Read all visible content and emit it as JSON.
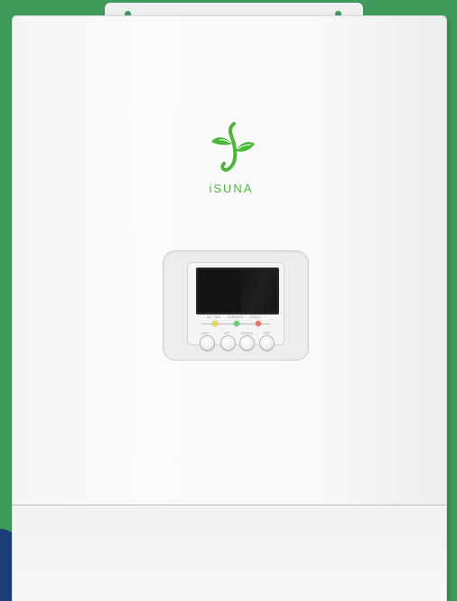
{
  "brand": {
    "name": "iSUNA",
    "color": "#4cb63a"
  },
  "indicators": [
    {
      "label": "AC / INV",
      "color": "#f2d544"
    },
    {
      "label": "CHARGE",
      "color": "#5fd269"
    },
    {
      "label": "FAULT",
      "color": "#ef6e62"
    }
  ],
  "buttons": [
    {
      "label": "ESC"
    },
    {
      "label": "UP"
    },
    {
      "label": "DOWN"
    },
    {
      "label": "ENT"
    }
  ],
  "colors": {
    "background": "#3f9a5c",
    "housing": "#f7f8f8",
    "screen": "#141414"
  }
}
